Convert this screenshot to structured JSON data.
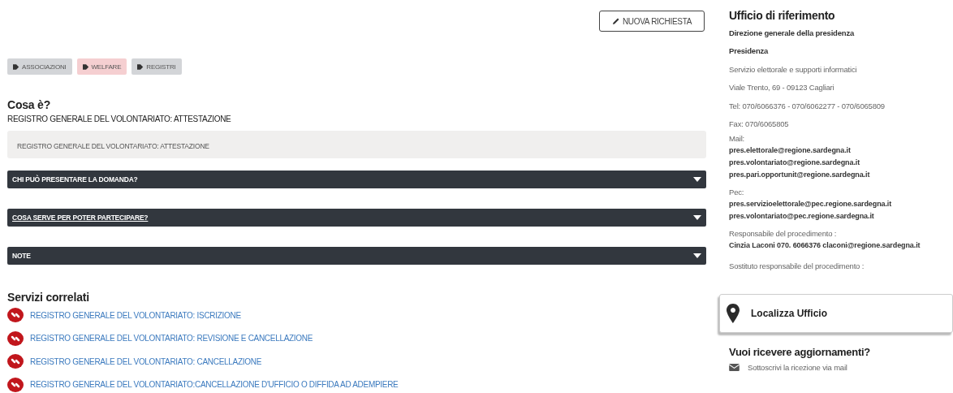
{
  "new_request_button": {
    "label": "NUOVA RICHIESTA"
  },
  "tags": [
    {
      "label": "ASSOCIAZIONI",
      "color": "#d3d5d8"
    },
    {
      "label": "WELFARE",
      "color": "#f5cfd1"
    },
    {
      "label": "REGISTRI",
      "color": "#d3d5d8"
    }
  ],
  "what_is": {
    "heading": "Cosa è?",
    "text": "REGISTRO GENERALE DEL VOLONTARIATO: ATTESTAZIONE",
    "box_text": "REGISTRO GENERALE DEL VOLONTARIATO: ATTESTAZIONE"
  },
  "accordions": [
    {
      "title": "CHI PUÒ PRESENTARE LA DOMANDA?",
      "expanded": false,
      "focused": false
    },
    {
      "title": "COSA SERVE PER POTER PARTECIPARE?",
      "expanded": false,
      "focused": true
    },
    {
      "title": "NOTE",
      "expanded": false,
      "focused": false
    }
  ],
  "related": {
    "heading": "Servizi correlati",
    "links": [
      "REGISTRO GENERALE DEL VOLONTARIATO: ISCRIZIONE",
      "REGISTRO GENERALE DEL VOLONTARIATO: REVISIONE E CANCELLAZIONE",
      "REGISTRO GENERALE DEL VOLONTARIATO: CANCELLAZIONE",
      "REGISTRO GENERALE DEL VOLONTARIATO:CANCELLAZIONE D'UFFICIO O DIFFIDA AD ADEMPIERE"
    ]
  },
  "office": {
    "heading": "Ufficio di riferimento",
    "direction": "Direzione generale della presidenza",
    "department": "Presidenza",
    "service": "Servizio elettorale e supporti informatici",
    "address": "Viale Trento, 69 - 09123 Cagliari",
    "phone": "Tel: 070/6066376 - 070/6062277 - 070/6065809",
    "fax": "Fax: 070/6065805",
    "mail_label": "Mail:",
    "mails": [
      "pres.elettorale@regione.sardegna.it",
      "pres.volontariato@regione.sardegna.it",
      "pres.pari.opportunit@regione.sardegna.it"
    ],
    "pec_label": "Pec:",
    "pecs": [
      "pres.servizioelettorale@pec.regione.sardegna.it",
      "pres.volontariato@pec.regione.sardegna.it"
    ],
    "manager_label": "Responsabile del procedimento :",
    "manager": "Cinzia Laconi 070. 6066376 claconi@regione.sardegna.it",
    "substitute_label": "Sostituto responsabile del procedimento :"
  },
  "locate_button": {
    "label": "Localizza Ufficio"
  },
  "updates": {
    "heading": "Vuoi ricevere aggiornamenti?",
    "link": "Sottoscrivi la ricezione via mail"
  }
}
